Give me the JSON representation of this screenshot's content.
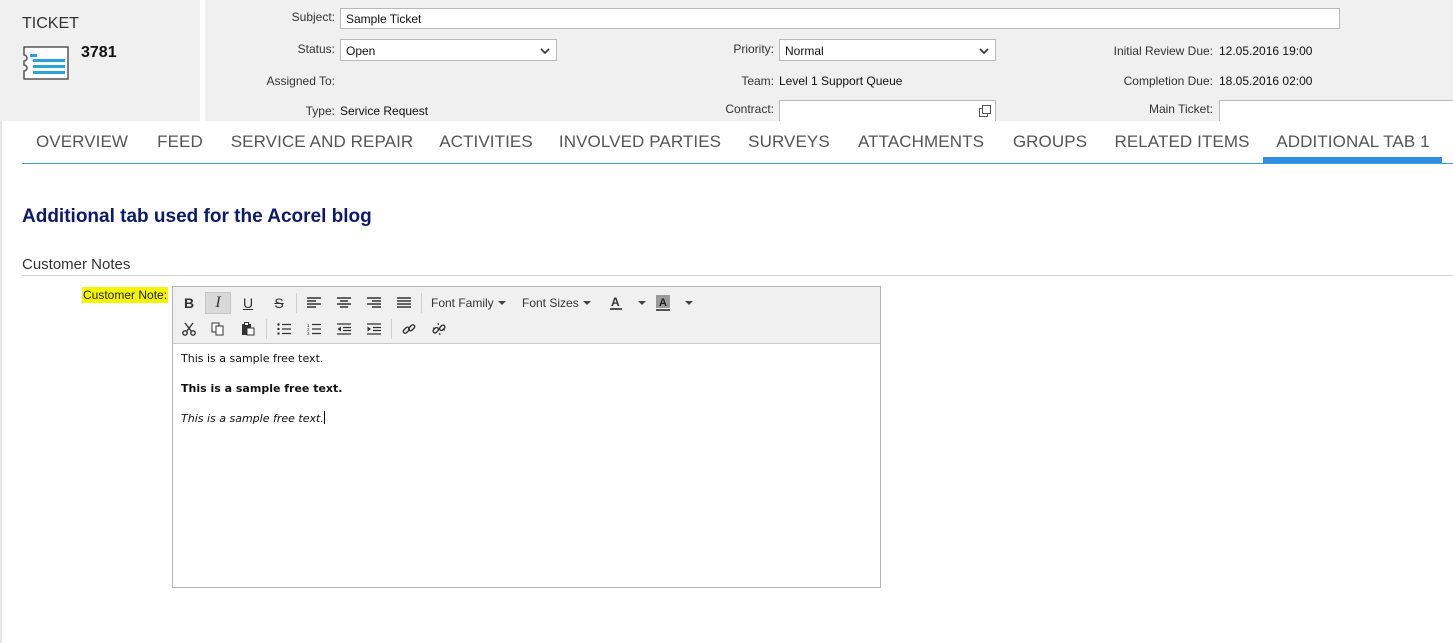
{
  "ticket": {
    "label": "TICKET",
    "number": "3781",
    "icon": "ticket-icon"
  },
  "fields": {
    "subject": {
      "label": "Subject:",
      "value": "Sample Ticket"
    },
    "status": {
      "label": "Status:",
      "value": "Open"
    },
    "priority": {
      "label": "Priority:",
      "value": "Normal"
    },
    "initial_review_due": {
      "label": "Initial Review Due:",
      "value": "12.05.2016 19:00"
    },
    "assigned_to": {
      "label": "Assigned To:",
      "value": ""
    },
    "team": {
      "label": "Team:",
      "value": "Level 1 Support Queue"
    },
    "completion_due": {
      "label": "Completion Due:",
      "value": "18.05.2016 02:00"
    },
    "type": {
      "label": "Type:",
      "value": "Service Request"
    },
    "contract": {
      "label": "Contract:",
      "value": ""
    },
    "main_ticket": {
      "label": "Main Ticket:",
      "value": ""
    }
  },
  "tabs": [
    {
      "label": "OVERVIEW"
    },
    {
      "label": "FEED"
    },
    {
      "label": "SERVICE AND REPAIR"
    },
    {
      "label": "ACTIVITIES"
    },
    {
      "label": "INVOLVED PARTIES"
    },
    {
      "label": "SURVEYS"
    },
    {
      "label": "ATTACHMENTS"
    },
    {
      "label": "GROUPS"
    },
    {
      "label": "RELATED ITEMS"
    },
    {
      "label": "ADDITIONAL TAB 1"
    }
  ],
  "active_tab": "ADDITIONAL TAB 1",
  "content": {
    "title": "Additional tab used for the Acorel blog",
    "section": "Customer Notes",
    "note_label": "Customer Note:"
  },
  "editor": {
    "toolbar": {
      "font_family": "Font Family",
      "font_sizes": "Font Sizes",
      "buttons": [
        "bold",
        "italic",
        "underline",
        "strikethrough",
        "align-left",
        "align-center",
        "align-right",
        "justify",
        "text-color",
        "background-color",
        "cut",
        "copy",
        "paste",
        "bullet-list",
        "numbered-list",
        "outdent",
        "indent",
        "link",
        "unlink"
      ],
      "pressed": "italic"
    },
    "lines": [
      "This is a sample free text.",
      "This is a sample free text.",
      "This is a sample free text."
    ]
  },
  "colors": {
    "header_bg": "#f0f0f0",
    "tab_accent": "#2f8ce0",
    "title_color": "#0d1a6b",
    "label_highlight": "#f5f500"
  }
}
